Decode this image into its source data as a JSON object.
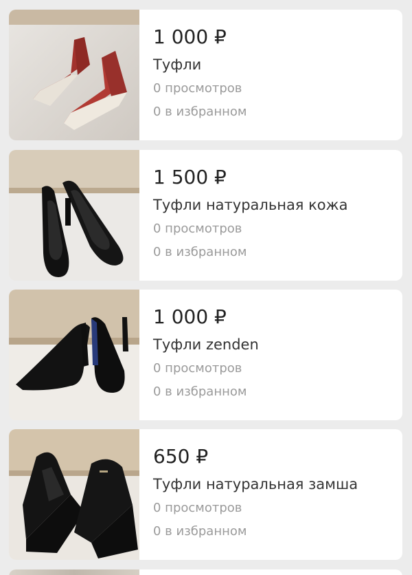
{
  "listings": [
    {
      "price": "1 000 ₽",
      "title": "Туфли",
      "views": "0 просмотров",
      "favorites": "0 в избранном",
      "image": "red-wedge-shoes-photo"
    },
    {
      "price": "1 500 ₽",
      "title": "Туфли натуральная кожа",
      "views": "0 просмотров",
      "favorites": "0 в избранном",
      "image": "black-leather-pumps-photo"
    },
    {
      "price": "1 000 ₽",
      "title": "Туфли zenden",
      "views": "0 просмотров",
      "favorites": "0 в избранном",
      "image": "black-suede-pumps-photo"
    },
    {
      "price": "650 ₽",
      "title": "Туфли натуральная замша",
      "views": "0 просмотров",
      "favorites": "0 в избранном",
      "image": "black-suede-wedge-photo"
    }
  ]
}
